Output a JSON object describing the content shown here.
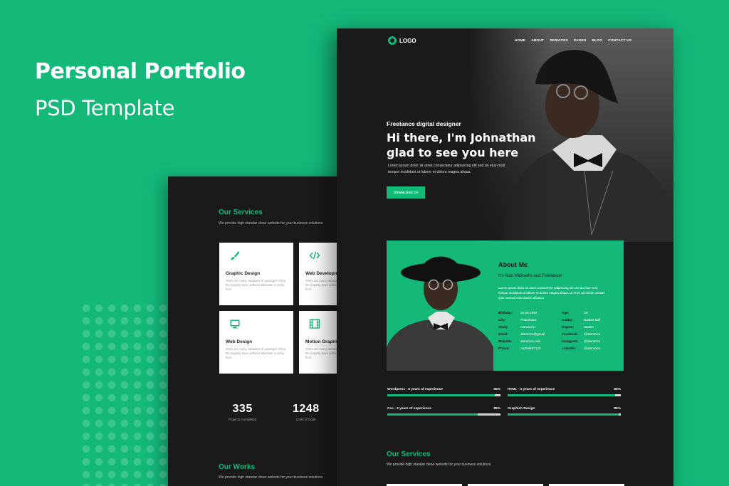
{
  "banner": {
    "title": "Personal Portfolio",
    "subtitle": "PSD Template"
  },
  "colors": {
    "accent": "#14b97a",
    "dark": "#1a1a1c",
    "white": "#ffffff"
  },
  "back_page": {
    "services_title": "Our Services",
    "services_sub": "We provide high standar clean website for your business solutions",
    "cards": [
      {
        "title": "Graphic Design",
        "icon": "brush-icon",
        "text": "There are many variations of passages of but the majority have suffered alteration in some form."
      },
      {
        "title": "Web Developm",
        "icon": "code-icon",
        "text": "There are many variations of passages of but the majority have suffered alteration in some form."
      },
      {
        "title": "Web Design",
        "icon": "monitor-icon",
        "text": "There are many variations of passages of but the majority have suffered alteration in some form."
      },
      {
        "title": "Motion Graphic",
        "icon": "film-icon",
        "text": "There are many variations of passages of but the majority have suffered alteration in some form."
      }
    ],
    "stats": [
      {
        "number": "335",
        "label": "Projects Completed"
      },
      {
        "number": "1248",
        "label": "Lines of Code"
      }
    ],
    "works_title": "Our Works",
    "works_sub": "We provide high standar clean website for your business solutions"
  },
  "front_page": {
    "logo": "LOGO",
    "nav": [
      "HOME",
      "ABOUT",
      "SERVICES",
      "PAGES",
      "BLOG",
      "CONTACT US"
    ],
    "hero_pre": "Freelance digital designer",
    "hero_title_1": "Hi there, I'm Johnathan",
    "hero_title_2": "glad to see you here",
    "hero_text": "Lorem ipsum dolor sit amet consectetur adipisicing elit sed do eius-mod tempor incididunt ut labore et dolore magna aliqua.",
    "button": "DOWNLOAD CV",
    "about": {
      "title": "About Me",
      "sub": "I'm Alan Michaelis and Freelancer",
      "desc": "Lorem ipsum dolor sit amet consectetur adipisicing elit sed do eius-mod tempor incididunt ut labore et dolore magna aliqua. Ut enim ad minim veniam quis nostrud exercitation ullamco.",
      "left": [
        {
          "k": "Birthday:",
          "v": "24.08.1993"
        },
        {
          "k": "City:",
          "v": "Polumbara"
        },
        {
          "k": "Study:",
          "v": "Harvard U"
        },
        {
          "k": "Email:",
          "v": "alanmics@gmail"
        },
        {
          "k": "Website:",
          "v": "alanmics.com"
        },
        {
          "k": "Phone:",
          "v": "+6284587123"
        }
      ],
      "right": [
        {
          "k": "Age:",
          "v": "25"
        },
        {
          "k": "Hobby:",
          "v": "Basket Ball"
        },
        {
          "k": "Degree:",
          "v": "Master"
        },
        {
          "k": "Facebook:",
          "v": "@alanmics"
        },
        {
          "k": "Instagram:",
          "v": "@alanmics"
        },
        {
          "k": "Linkedin:",
          "v": "@alanmics"
        }
      ]
    },
    "skills": [
      {
        "name": "Wordpress - 5 years of experience",
        "pct": "95%",
        "value": 95
      },
      {
        "name": "HTML - 4 years of experience",
        "pct": "95%",
        "value": 95
      },
      {
        "name": "Css - 3 years of experience",
        "pct": "85%",
        "value": 80
      },
      {
        "name": "Graphich Design",
        "pct": "85%",
        "value": 98
      }
    ],
    "services_title": "Our Services",
    "services_sub": "We provide high standar clean website for your business solutions"
  }
}
